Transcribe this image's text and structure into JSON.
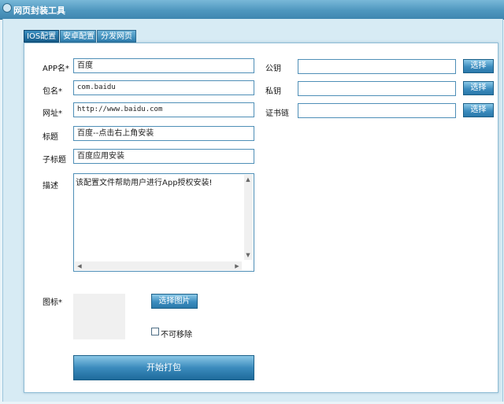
{
  "window": {
    "title": "网页封装工具"
  },
  "tabs": [
    {
      "label": "IOS配置",
      "active": true
    },
    {
      "label": "安卓配置",
      "active": false
    },
    {
      "label": "分发网页",
      "active": false
    }
  ],
  "form": {
    "app_name": {
      "label": "APP名*",
      "value": "百度"
    },
    "package_name": {
      "label": "包名*",
      "value": "com.baidu"
    },
    "url": {
      "label": "网址*",
      "value": "http://www.baidu.com"
    },
    "title": {
      "label": "标题",
      "value": "百度--点击右上角安装"
    },
    "subtitle": {
      "label": "子标题",
      "value": "百度应用安装"
    },
    "description": {
      "label": "描述",
      "value": "该配置文件帮助用户进行App授权安装!"
    },
    "icon": {
      "label": "图标*",
      "choose_label": "选择图片",
      "checkbox_label": "不可移除"
    },
    "start_label": "开始打包"
  },
  "keys": {
    "public_key": {
      "label": "公钥",
      "value": "",
      "button": "选择"
    },
    "private_key": {
      "label": "私钥",
      "value": "",
      "button": "选择"
    },
    "cert_chain": {
      "label": "证书链",
      "value": "",
      "button": "选择"
    }
  },
  "colors": {
    "accent": "#3c8dbf",
    "titlebar": "#4f97bf",
    "border": "#4f8fb7"
  }
}
